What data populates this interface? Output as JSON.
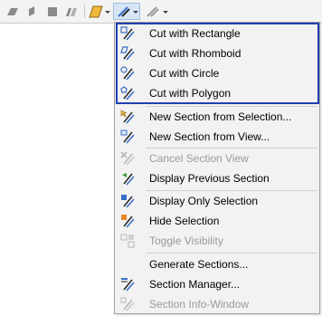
{
  "toolbar": {
    "icons": [
      "plane-icon",
      "slice-icon",
      "box-icon",
      "section-planes-icon",
      "section-color-icon",
      "section-cut-icon",
      "section-cut-alt-icon"
    ]
  },
  "menu": {
    "cut_group": [
      {
        "label": "Cut with Rectangle",
        "icon": "cut-rectangle-icon",
        "enabled": true
      },
      {
        "label": "Cut with Rhomboid",
        "icon": "cut-rhomboid-icon",
        "enabled": true
      },
      {
        "label": "Cut with Circle",
        "icon": "cut-circle-icon",
        "enabled": true
      },
      {
        "label": "Cut with Polygon",
        "icon": "cut-polygon-icon",
        "enabled": true
      }
    ],
    "new_group": [
      {
        "label": "New Section from Selection...",
        "icon": "new-section-selection-icon",
        "enabled": true
      },
      {
        "label": "New Section from View...",
        "icon": "new-section-view-icon",
        "enabled": true
      }
    ],
    "cancel_group": [
      {
        "label": "Cancel Section View",
        "icon": "cancel-section-icon",
        "enabled": false
      },
      {
        "label": "Display Previous Section",
        "icon": "previous-section-icon",
        "enabled": true
      }
    ],
    "display_group": [
      {
        "label": "Display Only Selection",
        "icon": "display-only-selection-icon",
        "enabled": true
      },
      {
        "label": "Hide Selection",
        "icon": "hide-selection-icon",
        "enabled": true
      },
      {
        "label": "Toggle Visibility",
        "icon": "toggle-visibility-icon",
        "enabled": false
      }
    ],
    "manage_group": [
      {
        "label": "Generate Sections...",
        "icon": "",
        "enabled": true
      },
      {
        "label": "Section Manager...",
        "icon": "section-manager-icon",
        "enabled": true
      },
      {
        "label": "Section Info-Window",
        "icon": "section-info-icon",
        "enabled": false
      }
    ]
  },
  "colors": {
    "highlight_border": "#1f3fb0",
    "icon_blue": "#3a6fc8",
    "icon_dark": "#2a2a2a",
    "icon_orange": "#e8872a",
    "icon_green": "#3a9a3a"
  }
}
